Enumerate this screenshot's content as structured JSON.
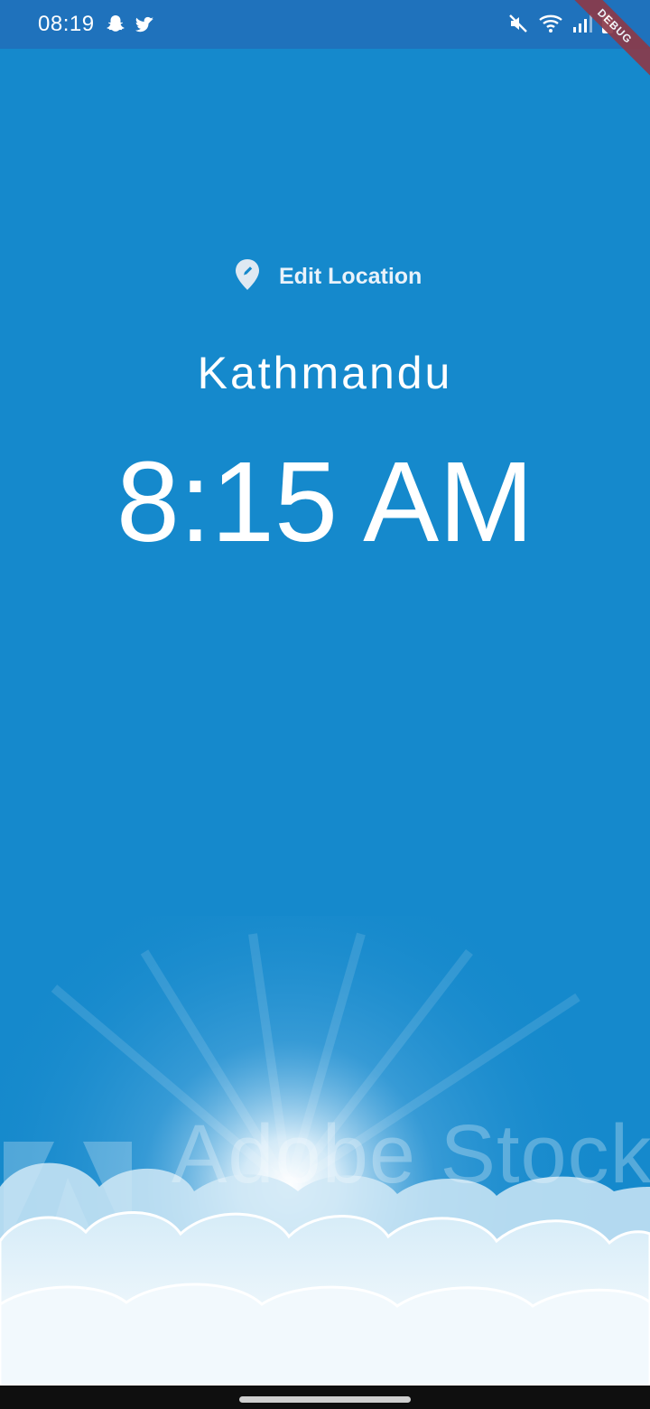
{
  "status_bar": {
    "time": "08:19",
    "left_icons": [
      "snapchat-icon",
      "twitter-icon"
    ],
    "right_icons": [
      "mute-icon",
      "wifi-icon",
      "signal-icon",
      "battery-icon"
    ],
    "debug_label": "DEBUG"
  },
  "main": {
    "edit_location": {
      "label": "Edit Location",
      "icon": "location-edit-icon"
    },
    "location": "Kathmandu",
    "time": "8:15 AM",
    "background_color": "#1589cc",
    "background_image": {
      "description_icon": "sky-clouds-image",
      "watermark": "Adobe Stock"
    }
  },
  "colors": {
    "status_bar": "#1f72bc",
    "background": "#1589cc",
    "text": "#ffffff",
    "debug_banner": "#8b3a4a"
  }
}
